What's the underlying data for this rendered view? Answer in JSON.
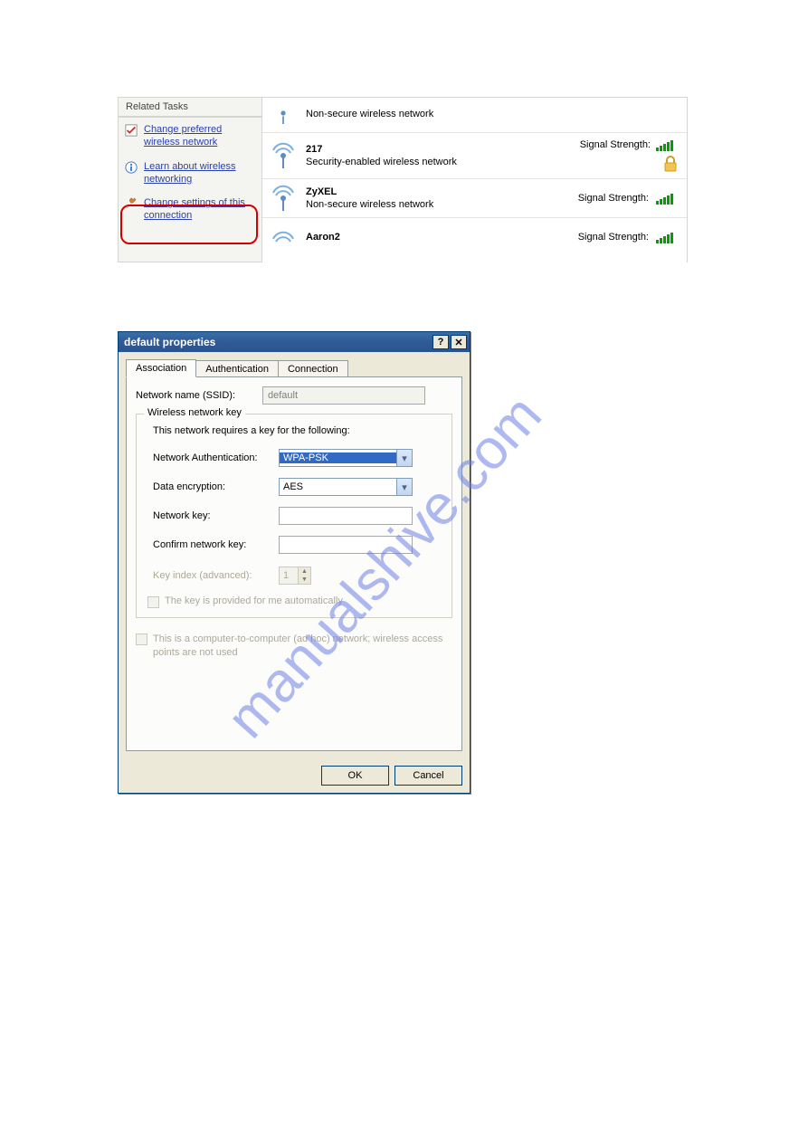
{
  "sidebar": {
    "header": "Related Tasks",
    "items": [
      {
        "icon": "checkbox-sheet-icon",
        "label": "Change preferred wireless network"
      },
      {
        "icon": "info-icon",
        "label": "Learn about wireless networking"
      },
      {
        "icon": "wrench-icon",
        "label": "Change settings of this connection"
      }
    ]
  },
  "networks": [
    {
      "name": "",
      "sub": "Non-secure wireless network",
      "signal_label": "",
      "locked": false,
      "partial": true
    },
    {
      "name": "217",
      "sub": "Security-enabled wireless network",
      "signal_label": "Signal Strength:",
      "locked": true
    },
    {
      "name": "ZyXEL",
      "sub": "Non-secure wireless network",
      "signal_label": "Signal Strength:",
      "locked": false
    },
    {
      "name": "Aaron2",
      "sub": "",
      "signal_label": "Signal Strength:",
      "locked": false,
      "partialbottom": true
    }
  ],
  "dialog": {
    "title": "default properties",
    "tabs": {
      "association": "Association",
      "authentication": "Authentication",
      "connection": "Connection"
    },
    "ssid_label": "Network name (SSID):",
    "ssid_value": "default",
    "fieldset_legend": "Wireless network key",
    "fieldset_note": "This network requires a key for the following:",
    "auth_label": "Network Authentication:",
    "auth_value": "WPA-PSK",
    "enc_label": "Data encryption:",
    "enc_value": "AES",
    "netkey_label": "Network key:",
    "confirmkey_label": "Confirm network key:",
    "keyindex_label": "Key index (advanced):",
    "keyindex_value": "1",
    "key_auto_label": "The key is provided for me automatically",
    "adhoc_label": "This is a computer-to-computer (ad hoc) network; wireless access points are not used",
    "ok": "OK",
    "cancel": "Cancel"
  },
  "watermark": "manualshive.com"
}
